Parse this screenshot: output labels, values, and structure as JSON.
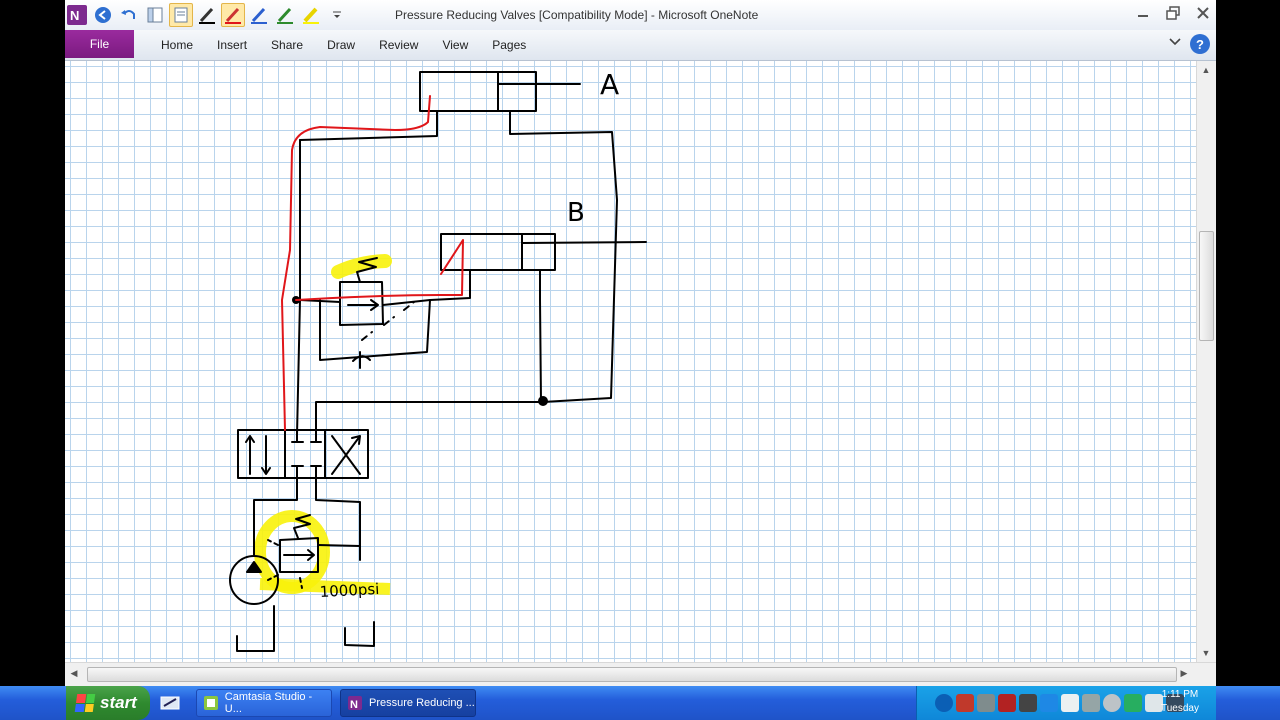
{
  "window": {
    "title": "Pressure Reducing Valves [Compatibility Mode]  -  Microsoft OneNote"
  },
  "ribbon": {
    "file_label": "File",
    "tabs": [
      "Home",
      "Insert",
      "Share",
      "Draw",
      "Review",
      "View",
      "Pages"
    ]
  },
  "drawing": {
    "labels": {
      "cylinder_a": "A",
      "cylinder_b": "B",
      "relief_setting": "1000psi"
    },
    "colors": {
      "ink": "#000000",
      "flow_path": "#e0161a",
      "highlight": "#f8f20a",
      "grid": "#b9d4ec"
    }
  },
  "taskbar": {
    "start_label": "start",
    "items": [
      {
        "label": "Camtasia Studio - U...",
        "icon": "camtasia-icon",
        "active": false
      },
      {
        "label": "Pressure Reducing ...",
        "icon": "onenote-icon",
        "active": true
      }
    ],
    "clock_time": "1:11 PM",
    "clock_day": "Tuesday"
  }
}
